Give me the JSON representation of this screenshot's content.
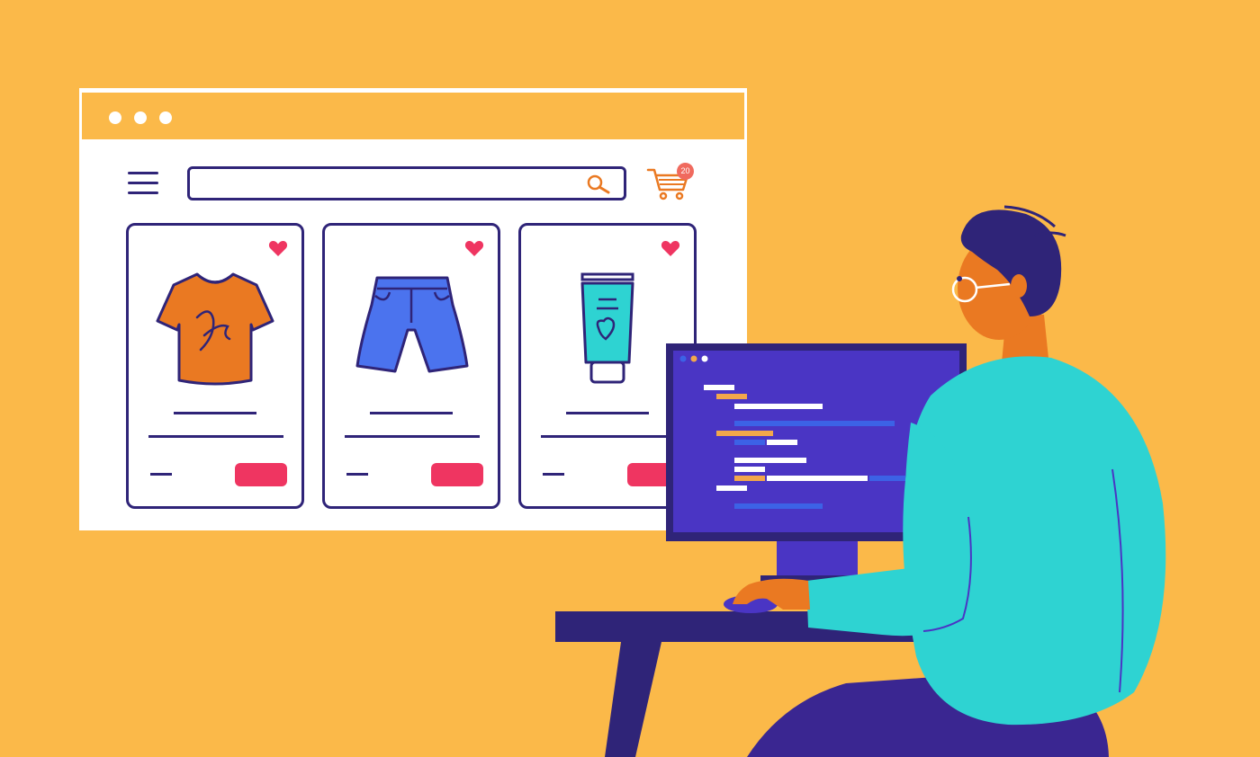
{
  "scene": {
    "background_color": "#FBB949",
    "accent_colors": {
      "navy": "#2F2478",
      "turquoise": "#2ED3D2",
      "skin": "#EA7922",
      "screen": "#4A35C4",
      "button_pink": "#EF3561",
      "heart_red": "#EF3561",
      "code_blue": "#3C62E6",
      "code_orange": "#F2A74B"
    }
  },
  "browser": {
    "titlebar_dots": [
      "dot-close",
      "dot-minimize",
      "dot-maximize"
    ],
    "menu_icon": "hamburger-icon",
    "search": {
      "value": "",
      "placeholder": "",
      "icon": "search-icon"
    },
    "cart": {
      "icon": "shopping-cart-icon",
      "badge_count": "20"
    },
    "products": [
      {
        "item": "t-shirt-icon",
        "shirt_color": "#EA7922",
        "favorite_icon": "heart-icon"
      },
      {
        "item": "shorts-icon",
        "shorts_color": "#4B73EE",
        "favorite_icon": "heart-icon"
      },
      {
        "item": "cream-tube-icon",
        "tube_color": "#2ED3D2",
        "favorite_icon": "heart-icon"
      }
    ]
  },
  "monitor": {
    "window_dots_colors": [
      "#3C62E6",
      "#F2A74B",
      "#FFFFFF"
    ]
  }
}
